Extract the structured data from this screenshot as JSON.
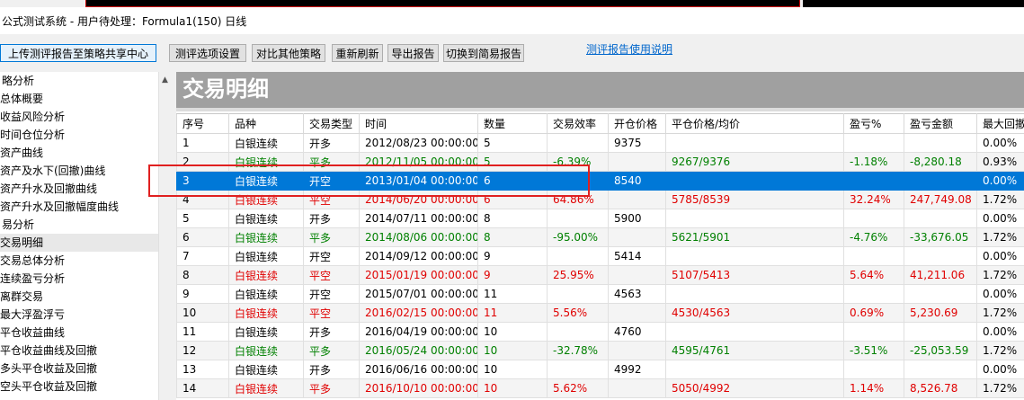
{
  "window": {
    "title": "公式测试系统 - 用户待处理：Formula1(150) 日线"
  },
  "toolbar": {
    "upload_label": "上传测评报告至策略共享中心",
    "options_label": "测评选项设置",
    "compare_label": "对比其他策略",
    "refresh_label": "重新刷新",
    "export_label": "导出报告",
    "switch_label": "切换到简易报告",
    "help_link": "测评报告使用说明"
  },
  "tree": {
    "items": [
      {
        "label": "略分析",
        "level": 1
      },
      {
        "label": "总体概要",
        "level": 2
      },
      {
        "label": "收益风险分析",
        "level": 2
      },
      {
        "label": "时间仓位分析",
        "level": 2
      },
      {
        "label": "资产曲线",
        "level": 2
      },
      {
        "label": "资产及水下(回撤)曲线",
        "level": 2
      },
      {
        "label": "资产升水及回撤曲线",
        "level": 2
      },
      {
        "label": "资产升水及回撤幅度曲线",
        "level": 2
      },
      {
        "label": "易分析",
        "level": 1
      },
      {
        "label": "交易明细",
        "level": 2,
        "selected": true
      },
      {
        "label": "交易总体分析",
        "level": 2
      },
      {
        "label": "连续盈亏分析",
        "level": 2
      },
      {
        "label": "离群交易",
        "level": 2
      },
      {
        "label": "最大浮盈浮亏",
        "level": 2
      },
      {
        "label": "平仓收益曲线",
        "level": 2
      },
      {
        "label": "平仓收益曲线及回撤",
        "level": 2
      },
      {
        "label": "多头平仓收益及回撤",
        "level": 2
      },
      {
        "label": "空头平仓收益及回撤",
        "level": 2
      }
    ]
  },
  "banner": {
    "title": "交易明细"
  },
  "table": {
    "columns": [
      "序号",
      "品种",
      "交易类型",
      "时间",
      "数量",
      "交易效率",
      "开仓价格",
      "平仓价格/均价",
      "盈亏%",
      "盈亏金额",
      "最大回撤"
    ],
    "rows": [
      {
        "cells": [
          "1",
          "白银连续",
          "开多",
          "2012/08/23 00:00:00",
          "5",
          "",
          "9375",
          "",
          "",
          "",
          "0.00%"
        ],
        "color": "black"
      },
      {
        "cells": [
          "2",
          "白银连续",
          "平多",
          "2012/11/05 00:00:00",
          "5",
          "-6.39%",
          "",
          "9267/9376",
          "-1.18%",
          "-8,280.18",
          "0.93%"
        ],
        "color": "green"
      },
      {
        "cells": [
          "3",
          "白银连续",
          "开空",
          "2013/01/04 00:00:00",
          "6",
          "",
          "8540",
          "",
          "",
          "",
          "0.00%"
        ],
        "color": "black",
        "selected": true
      },
      {
        "cells": [
          "4",
          "白银连续",
          "平空",
          "2014/06/20 00:00:00",
          "6",
          "64.86%",
          "",
          "5785/8539",
          "32.24%",
          "247,749.08",
          "1.72%"
        ],
        "color": "red"
      },
      {
        "cells": [
          "5",
          "白银连续",
          "开多",
          "2014/07/11 00:00:00",
          "8",
          "",
          "5900",
          "",
          "",
          "",
          "0.00%"
        ],
        "color": "black"
      },
      {
        "cells": [
          "6",
          "白银连续",
          "平多",
          "2014/08/06 00:00:00",
          "8",
          "-95.00%",
          "",
          "5621/5901",
          "-4.76%",
          "-33,676.05",
          "1.72%"
        ],
        "color": "green"
      },
      {
        "cells": [
          "7",
          "白银连续",
          "开空",
          "2014/09/12 00:00:00",
          "9",
          "",
          "5414",
          "",
          "",
          "",
          "0.00%"
        ],
        "color": "black"
      },
      {
        "cells": [
          "8",
          "白银连续",
          "平空",
          "2015/01/19 00:00:00",
          "9",
          "25.95%",
          "",
          "5107/5413",
          "5.64%",
          "41,211.06",
          "1.72%"
        ],
        "color": "red"
      },
      {
        "cells": [
          "9",
          "白银连续",
          "开空",
          "2015/07/01 00:00:00",
          "11",
          "",
          "4563",
          "",
          "",
          "",
          "0.00%"
        ],
        "color": "black"
      },
      {
        "cells": [
          "10",
          "白银连续",
          "平空",
          "2016/02/15 00:00:00",
          "11",
          "5.56%",
          "",
          "4530/4563",
          "0.69%",
          "5,230.69",
          "1.72%"
        ],
        "color": "red"
      },
      {
        "cells": [
          "11",
          "白银连续",
          "开多",
          "2016/04/19 00:00:00",
          "10",
          "",
          "4760",
          "",
          "",
          "",
          "0.00%"
        ],
        "color": "black"
      },
      {
        "cells": [
          "12",
          "白银连续",
          "平多",
          "2016/05/24 00:00:00",
          "10",
          "-32.78%",
          "",
          "4595/4761",
          "-3.51%",
          "-25,053.59",
          "1.72%"
        ],
        "color": "green"
      },
      {
        "cells": [
          "13",
          "白银连续",
          "开多",
          "2016/06/16 00:00:00",
          "10",
          "",
          "4992",
          "",
          "",
          "",
          "0.00%"
        ],
        "color": "black"
      },
      {
        "cells": [
          "14",
          "白银连续",
          "平多",
          "2016/10/10 00:00:00",
          "10",
          "5.62%",
          "",
          "5050/4992",
          "1.14%",
          "8,526.78",
          "1.72%"
        ],
        "color": "red"
      }
    ]
  }
}
